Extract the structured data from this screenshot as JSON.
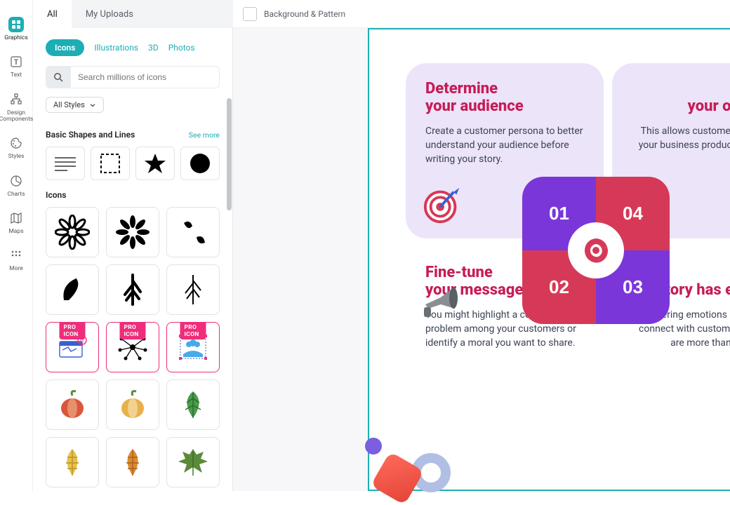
{
  "rail": {
    "items": [
      {
        "label": "Graphics"
      },
      {
        "label": "Text"
      },
      {
        "label": "Design\nComponents"
      },
      {
        "label": "Styles"
      },
      {
        "label": "Charts"
      },
      {
        "label": "Maps"
      },
      {
        "label": "More"
      }
    ]
  },
  "tabs": {
    "all": "All",
    "my_uploads": "My Uploads"
  },
  "panel": {
    "pills": {
      "icons": "Icons",
      "illustrations": "Illustrations",
      "threeD": "3D",
      "photos": "Photos"
    },
    "search_placeholder": "Search millions of icons",
    "styles_dd": "All Styles",
    "section_shapes": "Basic Shapes and Lines",
    "see_more": "See more",
    "section_icons": "Icons",
    "pro_badge": "PRO ICON"
  },
  "topbar": {
    "bg_pattern": "Background & Pattern"
  },
  "cards": {
    "c1": {
      "title": "Determine\nyour audience",
      "body": "Create a customer persona to better understand your audience before writing your story."
    },
    "c2": {
      "title": "Draft\nyour own story",
      "body": "This allows customers to visualize your business products or services can help."
    },
    "c3": {
      "title": "Fine-tune\nyour message",
      "body": "You might highlight a common problem among your customers or identify a moral you want to share."
    },
    "c4": {
      "title": "Every\nstory has emotions",
      "body": "Triggering emotions is how brands connect with customers. Emotions are more than encouraging."
    }
  },
  "quadrants": {
    "q1": "01",
    "q2": "04",
    "q3": "02",
    "q4": "03"
  }
}
